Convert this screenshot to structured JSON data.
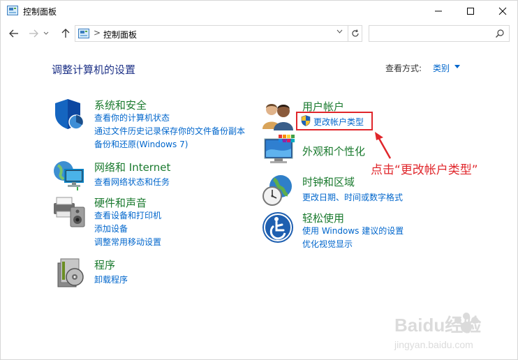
{
  "window": {
    "title": "控制面板"
  },
  "address": {
    "path": "控制面板",
    "separator": ">"
  },
  "content": {
    "heading": "调整计算机的设置",
    "view_by_label": "查看方式:",
    "view_by_value": "类别"
  },
  "categories": {
    "system": {
      "title": "系统和安全",
      "links": [
        "查看你的计算机状态",
        "通过文件历史记录保存你的文件备份副本",
        "备份和还原(Windows 7)"
      ]
    },
    "network": {
      "title": "网络和 Internet",
      "links": [
        "查看网络状态和任务"
      ]
    },
    "hardware": {
      "title": "硬件和声音",
      "links": [
        "查看设备和打印机",
        "添加设备",
        "调整常用移动设置"
      ]
    },
    "programs": {
      "title": "程序",
      "links": [
        "卸载程序"
      ]
    },
    "user": {
      "title": "用户帐户",
      "links": [
        "更改帐户类型"
      ]
    },
    "appearance": {
      "title": "外观和个性化",
      "links": []
    },
    "clock": {
      "title": "时钟和区域",
      "links": [
        "更改日期、时间或数字格式"
      ]
    },
    "ease": {
      "title": "轻松使用",
      "links": [
        "使用 Windows 建议的设置",
        "优化视觉显示"
      ]
    }
  },
  "annotation": {
    "text": "点击“更改帐户类型”"
  },
  "colors": {
    "link": "#0066cc",
    "category": "#1a7a2e",
    "heading": "#1e3287",
    "annotation": "#e0262b"
  },
  "watermark": {
    "brand": "Baidu经验",
    "url": "jingyan.baidu.com"
  }
}
